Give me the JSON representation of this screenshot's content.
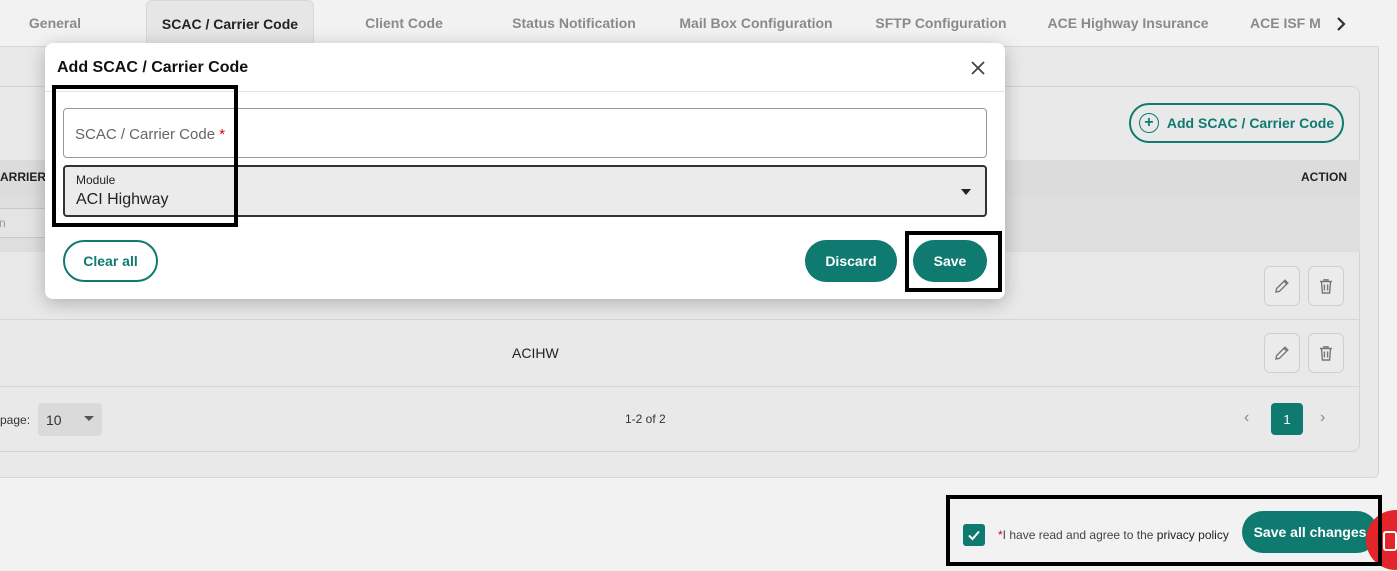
{
  "tabs": {
    "items": [
      {
        "label": "General"
      },
      {
        "label": "SCAC / Carrier Code"
      },
      {
        "label": "Client Code"
      },
      {
        "label": "Status Notification"
      },
      {
        "label": "Mail Box Configuration"
      },
      {
        "label": "SFTP Configuration"
      },
      {
        "label": "ACE Highway Insurance"
      },
      {
        "label": "ACE ISF M"
      }
    ],
    "active_index": 1,
    "next_icon": "chevron-right-icon"
  },
  "background": {
    "add_button_label": "Add SCAC / Carrier Code",
    "table": {
      "col_left_header": "ARRIER C",
      "col_action_header": "ACTION",
      "filter_placeholder": "n",
      "rows": [
        {
          "module": ""
        },
        {
          "module": "ACIHW"
        }
      ]
    },
    "pagination": {
      "rows_per_page_label": "page:",
      "rows_per_page": "10",
      "range": "1-2 of 2",
      "current_page": "1"
    }
  },
  "footer": {
    "consent_required_mark": "*",
    "consent_text": "I have read and agree to the ",
    "consent_link": "privacy policy",
    "consent_checked": true,
    "save_all_label": "Save all changes"
  },
  "modal": {
    "title": "Add SCAC / Carrier Code",
    "code_field": {
      "placeholder": "SCAC / Carrier Code",
      "required_mark": "*",
      "value": ""
    },
    "module_field": {
      "label": "Module",
      "value": "ACI Highway"
    },
    "clear_label": "Clear all",
    "discard_label": "Discard",
    "save_label": "Save"
  },
  "colors": {
    "accent": "#0e7a70",
    "required": "#d0021b",
    "fab": "#e3242b"
  }
}
